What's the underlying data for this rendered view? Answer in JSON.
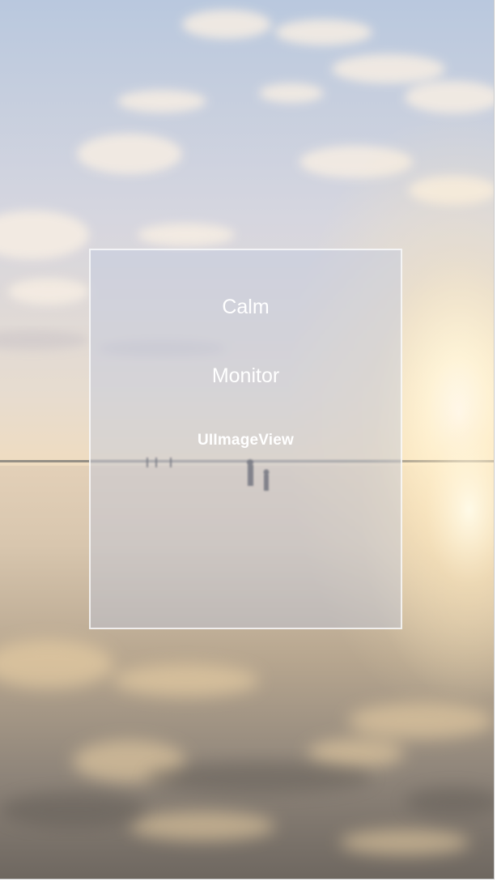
{
  "panel": {
    "title": "Calm",
    "subtitle": "Monitor",
    "caption": "UIImageView"
  },
  "colors": {
    "panel_tint": "#bec8e1",
    "panel_border": "#ffffff",
    "text": "#ffffff",
    "sky_top": "#b7c6dc",
    "horizon_glow": "#fff3d6",
    "water": "#7d776f"
  },
  "icons": {
    "background": "sunset-beach-photo"
  }
}
